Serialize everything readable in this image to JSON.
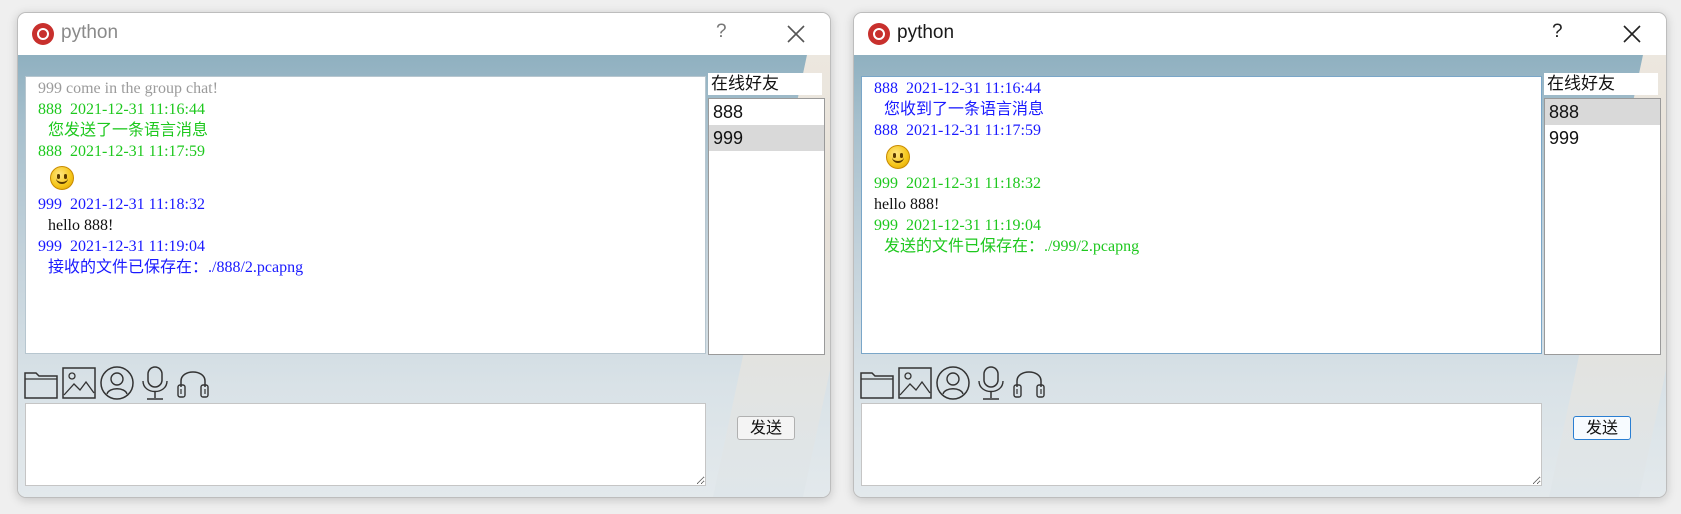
{
  "colors": {
    "gray_msg": "#9b9b9b",
    "green_msg": "#1ec81e",
    "blue_msg": "#1a1aff",
    "black_msg": "#111111",
    "selected_item": "#d9d9d9"
  },
  "windows": [
    {
      "title": "python",
      "help_label": "?",
      "close_icon": "close-icon",
      "chat": [
        {
          "kind": "text",
          "text": "999 come in the group chat!",
          "color": "#9b9b9b",
          "indent": false
        },
        {
          "kind": "text",
          "text": "888  2021-12-31 11:16:44",
          "color": "#1ec81e",
          "indent": false
        },
        {
          "kind": "text",
          "text": "您发送了一条语言消息",
          "color": "#1ec81e",
          "indent": true
        },
        {
          "kind": "text",
          "text": "888  2021-12-31 11:17:59",
          "color": "#1ec81e",
          "indent": false
        },
        {
          "kind": "emoji",
          "icon": "smiley-emoji-icon"
        },
        {
          "kind": "text",
          "text": "999  2021-12-31 11:18:32",
          "color": "#1a1aff",
          "indent": false
        },
        {
          "kind": "text",
          "text": "hello 888!",
          "color": "#111111",
          "indent": true
        },
        {
          "kind": "text",
          "text": "999  2021-12-31 11:19:04",
          "color": "#1a1aff",
          "indent": false
        },
        {
          "kind": "text",
          "text": "接收的文件已保存在：./888/2.pcapng",
          "color": "#1a1aff",
          "indent": true
        }
      ],
      "friends_label": "在线好友",
      "friends": [
        {
          "name": "888",
          "selected": false
        },
        {
          "name": "999",
          "selected": true
        }
      ],
      "toolbar": [
        "folder-icon",
        "image-icon",
        "avatar-icon",
        "microphone-icon",
        "headset-icon"
      ],
      "input_value": "",
      "send_label": "发送"
    },
    {
      "title": "python",
      "help_label": "?",
      "close_icon": "close-icon",
      "chat": [
        {
          "kind": "text",
          "text": "888  2021-12-31 11:16:44",
          "color": "#1a1aff",
          "indent": false
        },
        {
          "kind": "text",
          "text": "您收到了一条语言消息",
          "color": "#1a1aff",
          "indent": true
        },
        {
          "kind": "text",
          "text": "888  2021-12-31 11:17:59",
          "color": "#1a1aff",
          "indent": false
        },
        {
          "kind": "emoji",
          "icon": "smiley-emoji-icon"
        },
        {
          "kind": "text",
          "text": "999  2021-12-31 11:18:32",
          "color": "#1ec81e",
          "indent": false
        },
        {
          "kind": "text",
          "text": "hello 888!",
          "color": "#111111",
          "indent": false
        },
        {
          "kind": "text",
          "text": "999  2021-12-31 11:19:04",
          "color": "#1ec81e",
          "indent": false
        },
        {
          "kind": "text",
          "text": "发送的文件已保存在：./999/2.pcapng",
          "color": "#1ec81e",
          "indent": true
        }
      ],
      "friends_label": "在线好友",
      "friends": [
        {
          "name": "888",
          "selected": true
        },
        {
          "name": "999",
          "selected": false
        }
      ],
      "toolbar": [
        "folder-icon",
        "image-icon",
        "avatar-icon",
        "microphone-icon",
        "headset-icon"
      ],
      "input_value": "",
      "send_label": "发送"
    }
  ]
}
